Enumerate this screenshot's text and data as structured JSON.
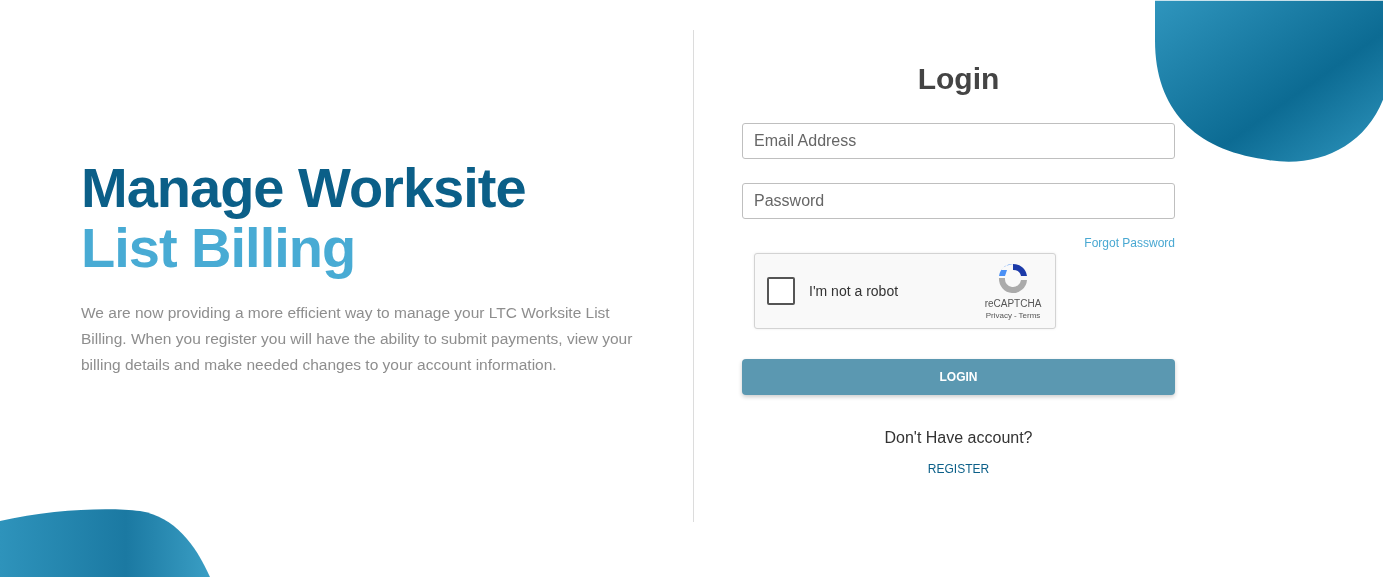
{
  "hero": {
    "title_line_1": "Manage Worksite",
    "title_line_2": "List Billing",
    "description": "We are now providing a more efficient way to manage your LTC Worksite List Billing. When you register you will have the ability to submit payments, view your billing details and make needed changes to your account information."
  },
  "login": {
    "title": "Login",
    "fields": [
      {
        "placeholder": "Email Address"
      },
      {
        "placeholder": "Password"
      }
    ],
    "forgot_link": "Forgot Password",
    "captcha": {
      "label": "I'm not a robot",
      "checked": false,
      "brand": "reCAPTCHA",
      "privacy": "Privacy",
      "separator": "-",
      "terms": "Terms"
    },
    "submit": "LOGIN",
    "prompt": "Don't Have account?",
    "register": "REGISTER"
  }
}
